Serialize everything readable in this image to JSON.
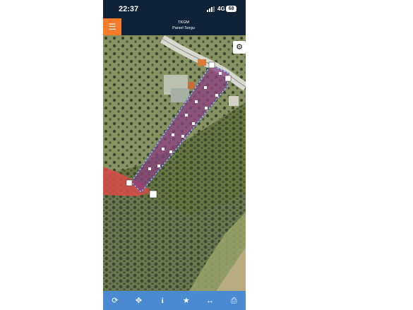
{
  "status": {
    "time": "22:37",
    "network": "4G",
    "battery": "68"
  },
  "header": {
    "title": "TKGM",
    "subtitle": "Parsel Sorgu"
  },
  "icons": {
    "menu": "☰",
    "settings": "⚙",
    "refresh": "⟳",
    "locate": "✥",
    "info": "i",
    "favorite": "★",
    "measure": "↔",
    "print": "⎙"
  },
  "colors": {
    "header_bg": "#0f2238",
    "menu_accent": "#f57c2a",
    "toolbar_bg": "#4a8ad0",
    "parcel_fill": "#8b3f7f",
    "neighbor_parcel": "#d94b46"
  }
}
